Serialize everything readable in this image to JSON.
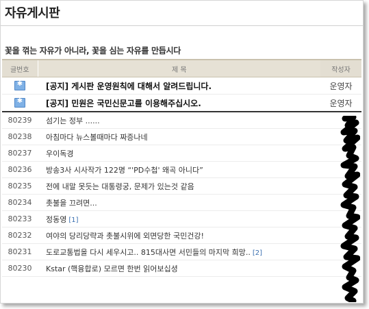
{
  "page": {
    "title": "자유게시판",
    "slogan": "꽃을 꺾는 자유가 아니라, 꽃을 심는 자유를 만듭시다"
  },
  "table": {
    "headers": {
      "number": "글번호",
      "subject": "제 목",
      "writer": "작성자"
    },
    "notices": [
      {
        "icon": "notice-icon",
        "subject": "[공지] 게시판 운영원칙에 대해서 알려드립니다.",
        "writer": "운영자"
      },
      {
        "icon": "notice-icon",
        "subject": "[공지] 민원은 국민신문고를 이용해주십시오.",
        "writer": "운영자"
      }
    ],
    "posts": [
      {
        "number": "80239",
        "subject": "섬기는 정부 ......",
        "comments": ""
      },
      {
        "number": "80238",
        "subject": "아침마다 뉴스볼때마다 짜증나네",
        "comments": ""
      },
      {
        "number": "80237",
        "subject": "우이독경",
        "comments": ""
      },
      {
        "number": "80236",
        "subject": "방송3사 시사작가 122명 “'PD수첩' 왜곡 아니다”",
        "comments": ""
      },
      {
        "number": "80235",
        "subject": "전에 내말 못듯는 대통령궁, 문제가 있는것 같음",
        "comments": ""
      },
      {
        "number": "80234",
        "subject": "촛불을 끄려면...",
        "comments": ""
      },
      {
        "number": "80233",
        "subject": "정동영",
        "comments": "[1]"
      },
      {
        "number": "80232",
        "subject": "여야의 당리당략과 촛불시위에 외면당한 국민건강!",
        "comments": ""
      },
      {
        "number": "80231",
        "subject": "도로교통법을 다시 세우시고.. 815대사면 서민들의 마지막 희망..",
        "comments": "[2]"
      },
      {
        "number": "80230",
        "subject": "Kstar (핵융합로) 모르면 한번 읽어보십셩",
        "comments": ""
      }
    ]
  }
}
